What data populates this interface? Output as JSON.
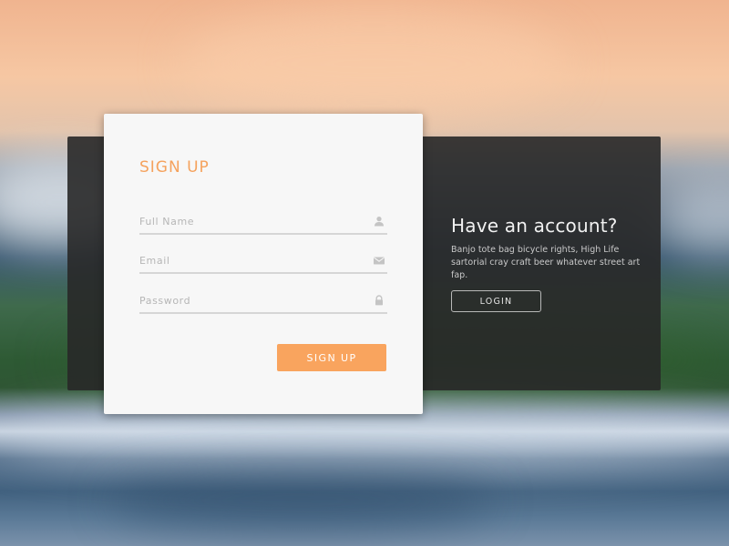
{
  "signup_card": {
    "title": "SIGN UP",
    "fields": [
      {
        "placeholder": "Full Name",
        "value": "",
        "icon": "user-icon"
      },
      {
        "placeholder": "Email",
        "value": "",
        "icon": "envelope-icon"
      },
      {
        "placeholder": "Password",
        "value": "",
        "icon": "lock-icon"
      }
    ],
    "submit_label": "SIGN UP"
  },
  "login_panel": {
    "title": "Have an account?",
    "description": "Banjo tote bag bicycle rights, High Life sartorial cray craft beer whatever street art fap.",
    "login_label": "LOGIN"
  },
  "colors": {
    "accent": "#f9a45e",
    "title_accent": "#f5a25d",
    "dark_panel": "#2b2b2b",
    "card_bg": "#f7f7f7"
  }
}
